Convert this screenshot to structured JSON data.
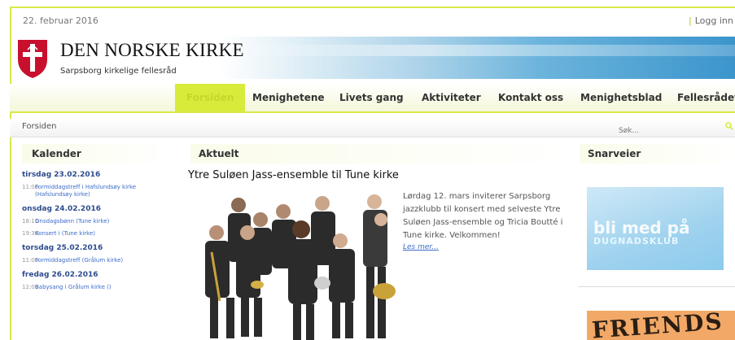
{
  "header": {
    "date": "22. februar 2016",
    "login_label": "Logg inn",
    "org_name": "DEN NORSKE KIRKE",
    "subtitle": "Sarpsborg kirkelige fellesråd"
  },
  "nav": {
    "items": [
      "Forsiden",
      "Menighetene",
      "Livets gang",
      "Aktiviteter",
      "Kontakt oss",
      "Menighetsblad",
      "Fellesrådet"
    ],
    "active": "Forsiden"
  },
  "breadcrumb": "Forsiden",
  "search": {
    "placeholder": "Søk..."
  },
  "calendar": {
    "heading": "Kalender",
    "days": [
      {
        "date": "tirsdag 23.02.2016",
        "events": [
          {
            "time": "11:00",
            "text": "Formiddagstreff i Hafslundsøy kirke (Hafslundsøy kirke)"
          }
        ]
      },
      {
        "date": "onsdag 24.02.2016",
        "events": [
          {
            "time": "18:15",
            "text": "Onsdagsbønn (Tune kirke)"
          },
          {
            "time": "19:30",
            "text": "Konsert i (Tune kirke)"
          }
        ]
      },
      {
        "date": "torsdag 25.02.2016",
        "events": [
          {
            "time": "11:00",
            "text": "Formiddagstreff (Grålum kirke)"
          }
        ]
      },
      {
        "date": "fredag 26.02.2016",
        "events": [
          {
            "time": "12:00",
            "text": "Babysang i Grålum kirke ()"
          }
        ]
      }
    ]
  },
  "news": {
    "heading": "Aktuelt",
    "title": "Ytre Suløen Jass-ensemble til Tune kirke",
    "body": "Lørdag 12. mars inviterer Sarpsborg jazzklubb til konsert med selveste Ytre Suløen Jass-ensemble og Tricia Boutté i Tune kirke. Velkommen!",
    "more": "Les mer..."
  },
  "shortcuts": {
    "heading": "Snarveier",
    "ad1_text": "bli med på",
    "ad1_sub": "DUGNADSKLUB",
    "ad2_text": "FRIENDS"
  },
  "colors": {
    "accent": "#d7ec3a",
    "link": "#3b6bc9",
    "day": "#2d4b8c"
  }
}
